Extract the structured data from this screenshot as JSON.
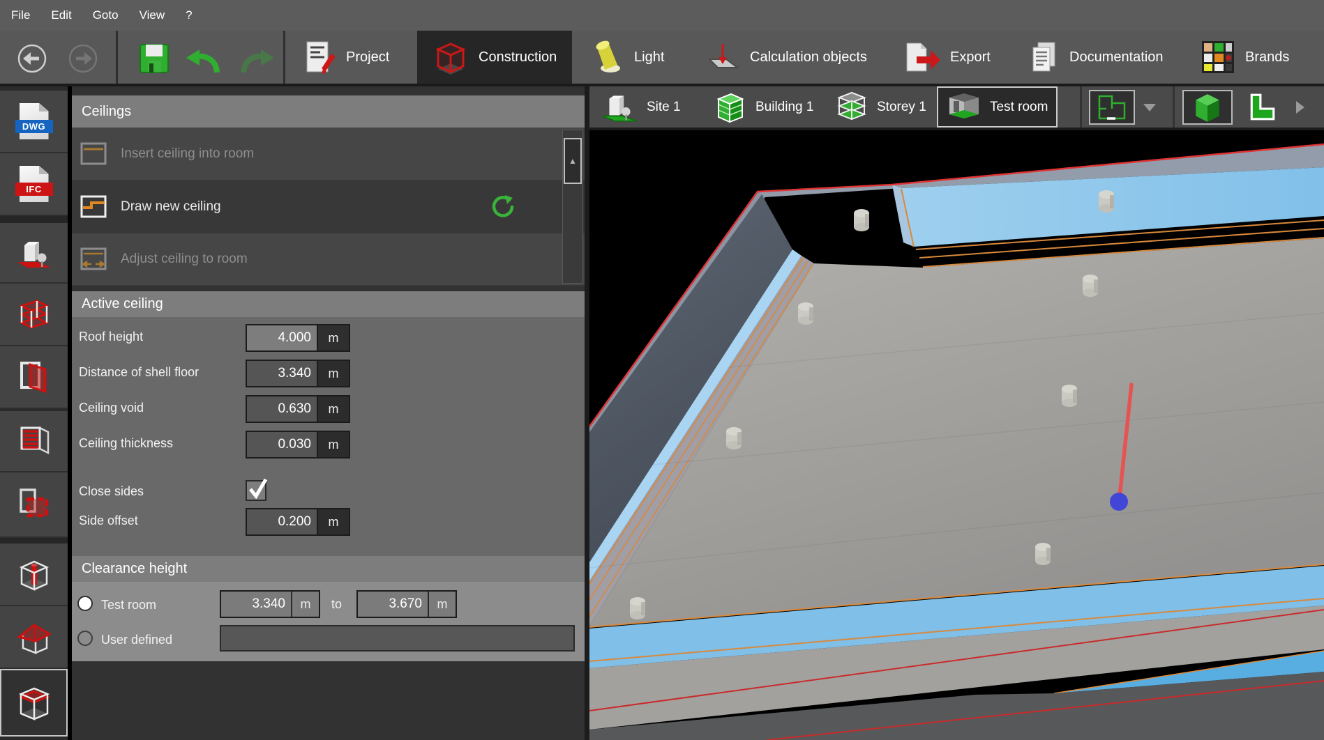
{
  "menu": {
    "items": [
      "File",
      "Edit",
      "Goto",
      "View",
      "?"
    ]
  },
  "toolbar": {
    "tabs": [
      {
        "label": "Project"
      },
      {
        "label": "Construction",
        "selected": true
      },
      {
        "label": "Light"
      },
      {
        "label": "Calculation objects"
      },
      {
        "label": "Export"
      },
      {
        "label": "Documentation"
      },
      {
        "label": "Brands"
      }
    ]
  },
  "sidebar": {
    "tools": [
      {
        "id": "dwg-import",
        "badge": "DWG"
      },
      {
        "id": "ifc-import",
        "badge": "IFC"
      },
      {
        "id": "site"
      },
      {
        "id": "storeys"
      },
      {
        "id": "door"
      },
      {
        "id": "window"
      },
      {
        "id": "opening"
      },
      {
        "id": "column"
      },
      {
        "id": "roof"
      },
      {
        "id": "ceiling",
        "selected": true
      }
    ]
  },
  "panel": {
    "title": "Ceilings",
    "tools": [
      {
        "label": "Insert ceiling into room",
        "enabled": false
      },
      {
        "label": "Draw new ceiling",
        "enabled": true,
        "selected": true
      },
      {
        "label": "Adjust ceiling to room",
        "enabled": false
      }
    ],
    "active_ceiling": {
      "title": "Active ceiling",
      "fields": [
        {
          "label": "Roof height",
          "value": "4.000",
          "unit": "m",
          "readonly": true
        },
        {
          "label": "Distance of shell floor",
          "value": "3.340",
          "unit": "m"
        },
        {
          "label": "Ceiling void",
          "value": "0.630",
          "unit": "m"
        },
        {
          "label": "Ceiling thickness",
          "value": "0.030",
          "unit": "m"
        }
      ],
      "close_sides": {
        "label": "Close sides",
        "checked": true
      },
      "side_offset": {
        "label": "Side offset",
        "value": "0.200",
        "unit": "m"
      }
    },
    "clearance": {
      "title": "Clearance height",
      "test_room": {
        "label": "Test room",
        "selected": true,
        "from": "3.340",
        "from_unit": "m",
        "to_word": "to",
        "to": "3.670",
        "to_unit": "m"
      },
      "user_defined": {
        "label": "User defined",
        "selected": false,
        "value": ""
      }
    }
  },
  "breadcrumb": {
    "items": [
      {
        "label": "Site 1"
      },
      {
        "label": "Building 1"
      },
      {
        "label": "Storey 1"
      },
      {
        "label": "Test room",
        "selected": true
      }
    ]
  },
  "colors": {
    "accent_green": "#2fae2f",
    "selection_red": "#cc2222",
    "edge_orange": "#d8893c",
    "ceiling_blue": "#8ac4eb",
    "marker_blue_dot": "#4246d6",
    "marker_red_line": "#e65353",
    "panel_header_gray": "#7d7d7d"
  }
}
